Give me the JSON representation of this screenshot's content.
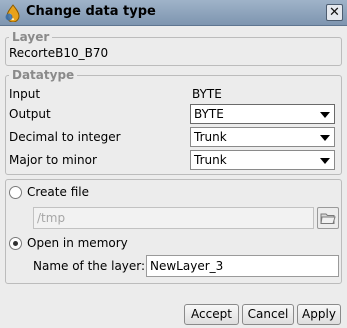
{
  "window": {
    "title": "Change data type",
    "app_icon": "gvsig-droplet-icon",
    "close_icon": "close-icon",
    "close_symbol": "✕"
  },
  "layer_section": {
    "legend": "Layer",
    "layer_name": "RecorteB10_B70"
  },
  "datatype_section": {
    "legend": "Datatype",
    "input_label": "Input",
    "input_value": "BYTE",
    "output_label": "Output",
    "output_value": "BYTE",
    "decimal_label": "Decimal to integer",
    "decimal_value": "Trunk",
    "major_label": "Major to minor",
    "major_value": "Trunk"
  },
  "destination_section": {
    "create_file_label": "Create file",
    "create_file_selected": false,
    "path_value": "/tmp",
    "folder_icon": "folder-open-icon",
    "open_memory_label": "Open in memory",
    "open_memory_selected": true,
    "layer_name_label": "Name of the layer:",
    "layer_name_value": "NewLayer_3"
  },
  "buttons": {
    "accept": "Accept",
    "cancel": "Cancel",
    "apply": "Apply"
  }
}
